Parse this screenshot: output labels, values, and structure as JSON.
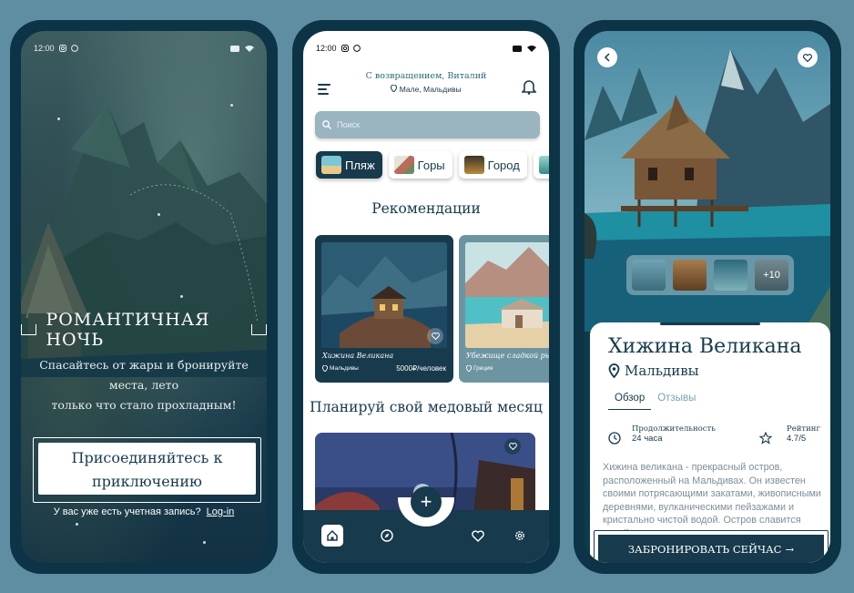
{
  "status_bar": {
    "time": "12:00"
  },
  "screen1": {
    "title": "РОМАНТИЧНАЯ НОЧЬ",
    "subtitle_line1": "Спасайтесь от жары и бронируйте места, лето",
    "subtitle_line2": "только что стало прохладным!",
    "join_line1": "Присоединяйтесь к",
    "join_line2": "приключению",
    "login_prompt": "У вас уже есть учетная запись?",
    "login_link": "Log-in"
  },
  "screen2": {
    "welcome": "С возвращением, Виталий",
    "location": "Мале, Мальдивы",
    "search_placeholder": "Поиск",
    "categories": [
      {
        "label": "Пляж",
        "active": true
      },
      {
        "label": "Горы",
        "active": false
      },
      {
        "label": "Город",
        "active": false
      }
    ],
    "recommendations_heading": "Рекомендации",
    "recommendations": [
      {
        "name": "Хижина Великана",
        "location": "Мальдивы",
        "price": "5000₽/человек"
      },
      {
        "name": "Убежище сладкой рыбы",
        "location": "Греция",
        "price": ""
      }
    ],
    "honeymoon_heading": "Планируй свой медовый месяц",
    "nav": {
      "plus": "+"
    }
  },
  "screen3": {
    "title": "Хижина Великана",
    "location": "Мальдивы",
    "tabs": [
      "Обзор",
      "Отзывы"
    ],
    "duration_label": "Продолжительность",
    "duration_value": "24 часа",
    "rating_label": "Рейтинг",
    "rating_value": "4.7/5",
    "thumbs_more": "+10",
    "description": "Хижина великана - прекрасный остров, расположенный на Мальдивах. Он известен своими потрясающими закатами, живописными деревнями, вулканическими пейзажами и кристально чистой водой. Остров славится своей",
    "book_label": "ЗАБРОНИРОВАТЬ СЕЙЧАС",
    "book_arrow": "→"
  },
  "colors": {
    "background": "#5f8ea3",
    "phone_frame": "#0c3446",
    "primary": "#173a4c",
    "search_bg": "#9ab4c0",
    "accent_text": "#2d6a78"
  }
}
